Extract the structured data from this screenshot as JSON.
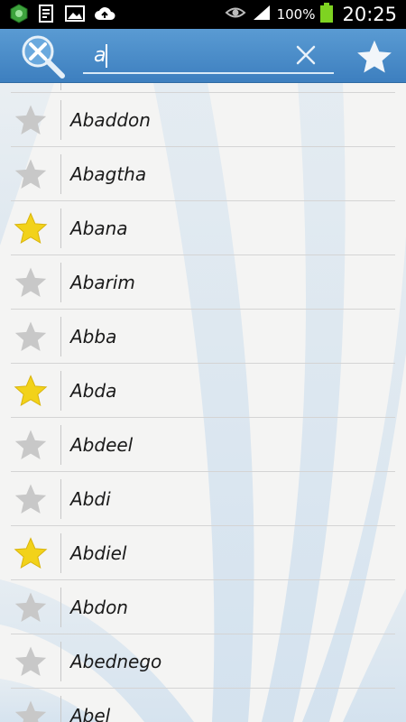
{
  "status_bar": {
    "battery_percent": "100%",
    "time": "20:25"
  },
  "search": {
    "value": "a"
  },
  "names": [
    {
      "label": "Abaddon",
      "favorite": false
    },
    {
      "label": "Abagtha",
      "favorite": false
    },
    {
      "label": "Abana",
      "favorite": true
    },
    {
      "label": "Abarim",
      "favorite": false
    },
    {
      "label": "Abba",
      "favorite": false
    },
    {
      "label": "Abda",
      "favorite": true
    },
    {
      "label": "Abdeel",
      "favorite": false
    },
    {
      "label": "Abdi",
      "favorite": false
    },
    {
      "label": "Abdiel",
      "favorite": true
    },
    {
      "label": "Abdon",
      "favorite": false
    },
    {
      "label": "Abednego",
      "favorite": false
    },
    {
      "label": "Abel",
      "favorite": false
    }
  ],
  "colors": {
    "star_favorite": "#f2d21a",
    "star_default": "#c8c8c8",
    "toolbar": "#4a8cc9"
  }
}
